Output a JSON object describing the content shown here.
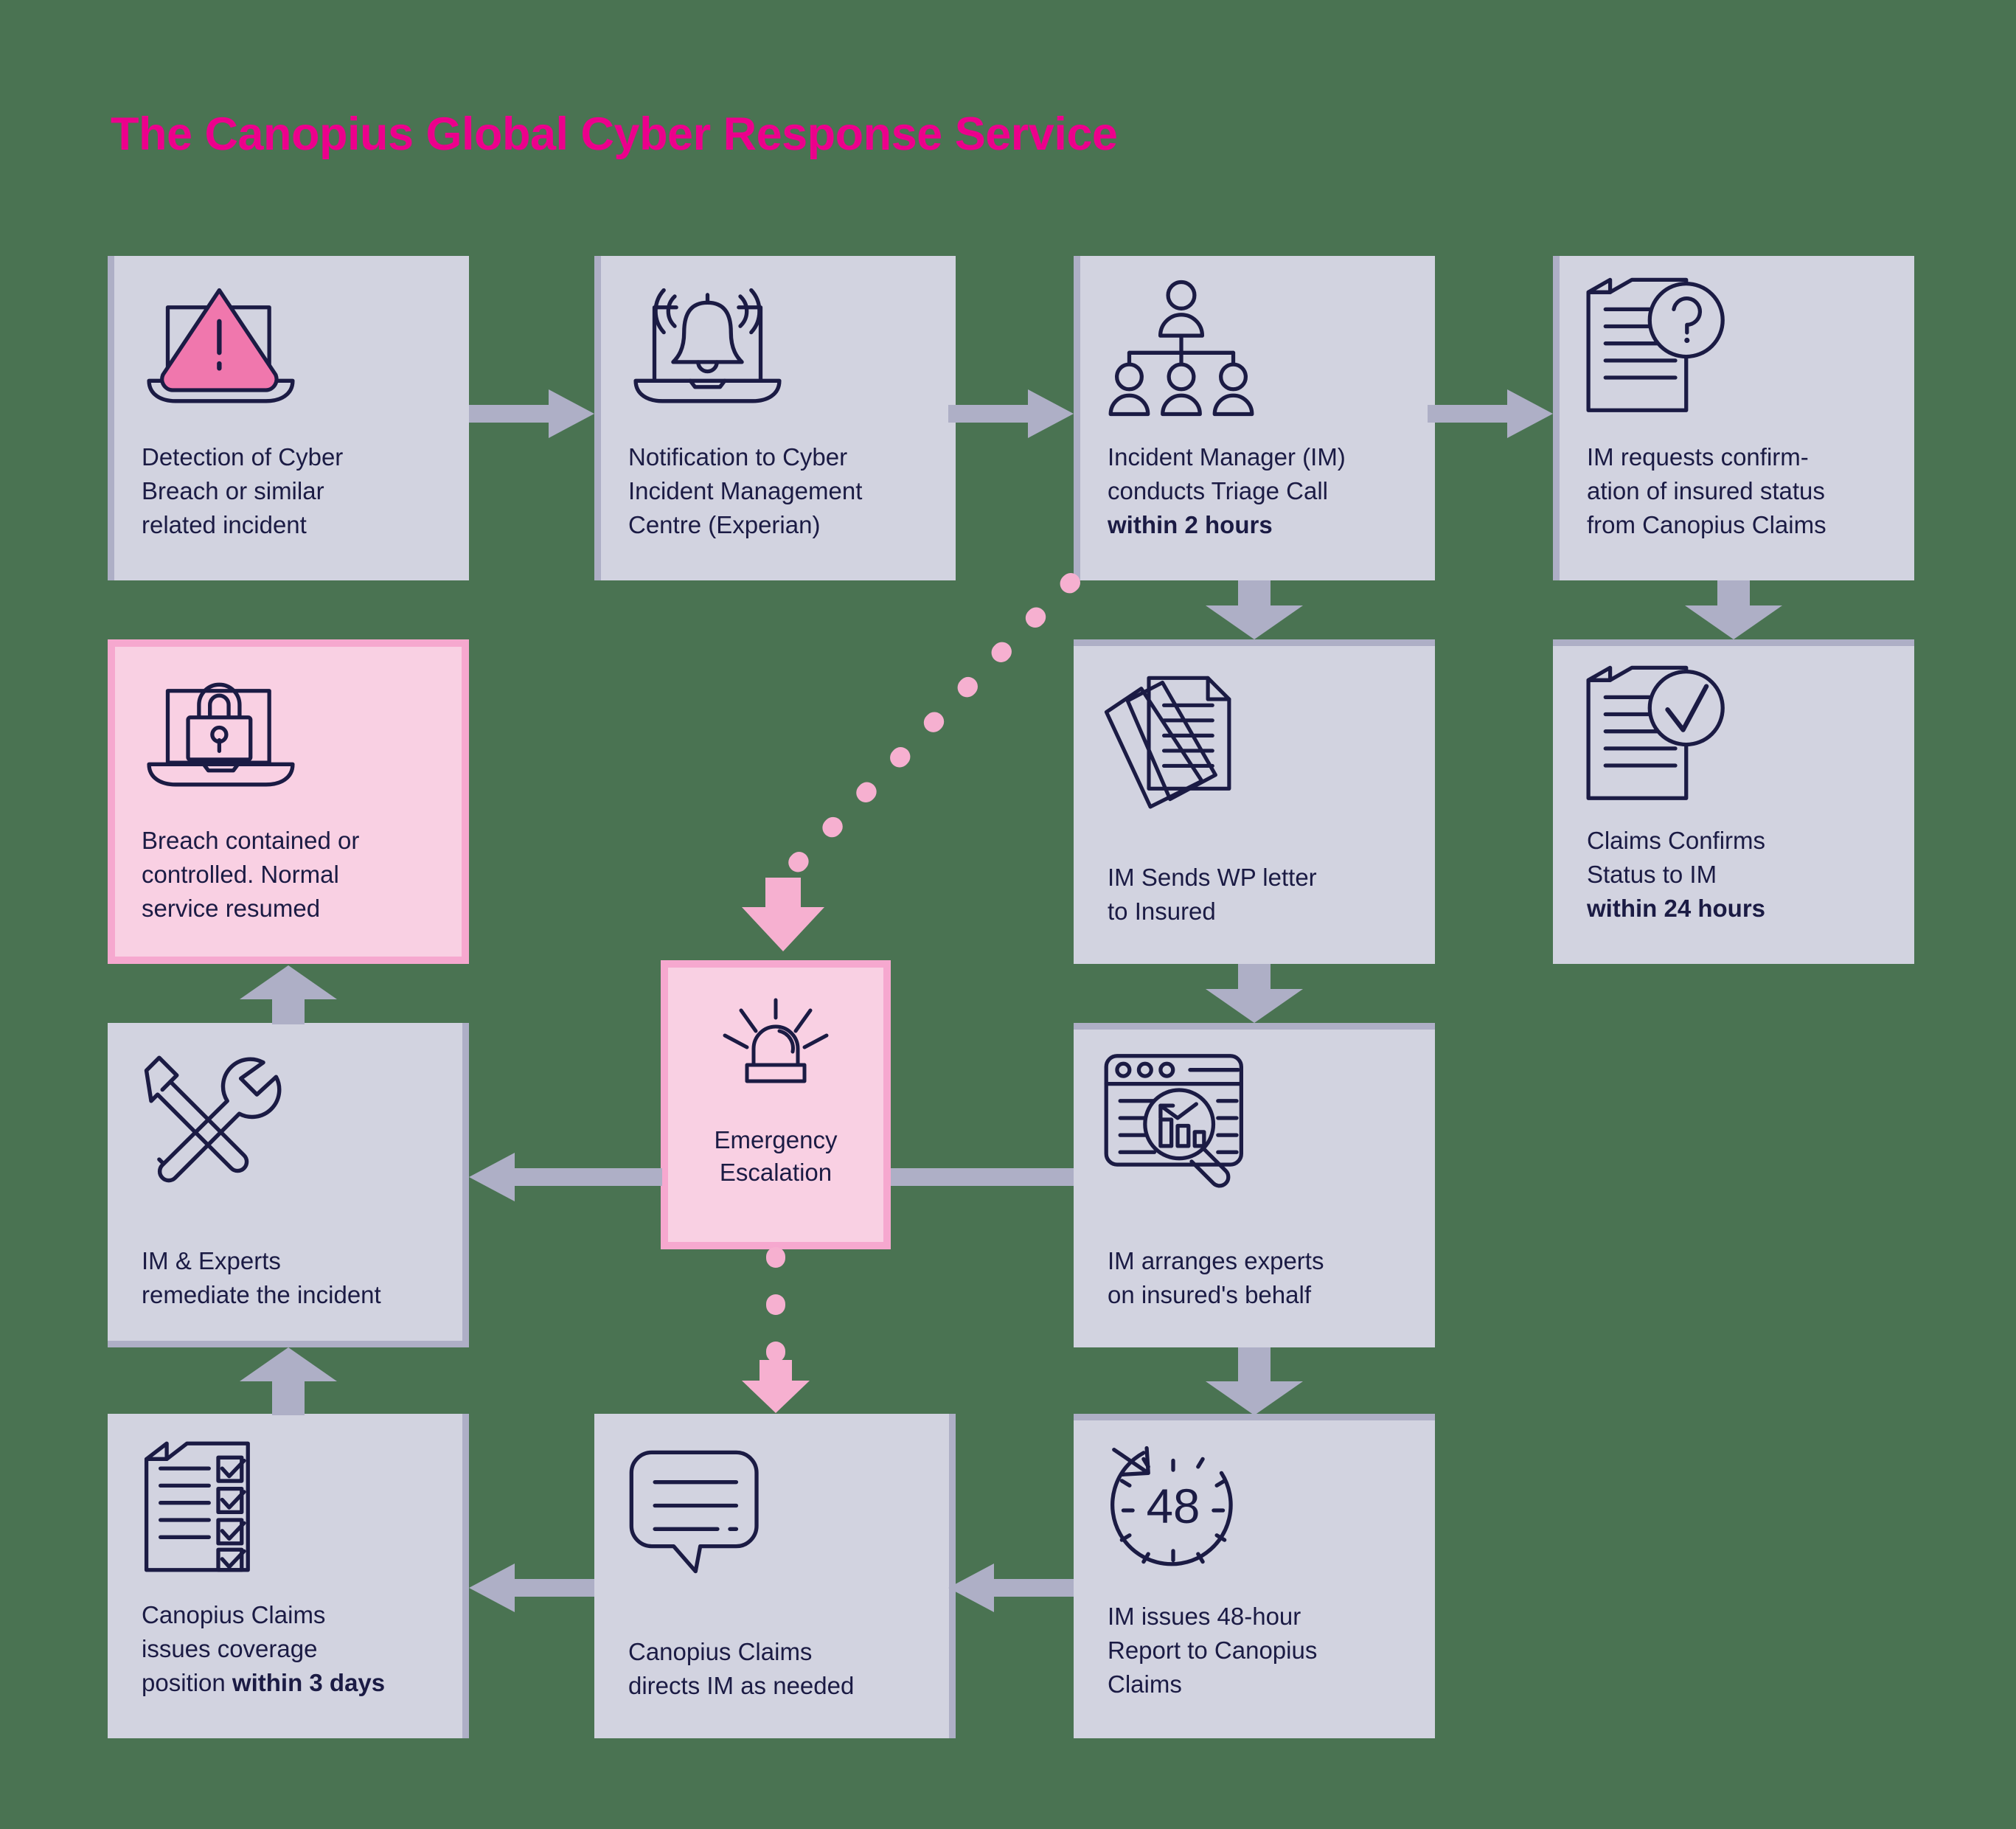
{
  "title": "The Canopius Global Cyber Response Service",
  "colors": {
    "background": "#4a7352",
    "title_pink": "#ec008c",
    "box_fill": "#d2d3e0",
    "box_edge": "#aeafc6",
    "pink_fill": "#f9d0e3",
    "pink_border": "#f6a8cf",
    "ink": "#1b1b44",
    "arrow_grey": "#aeafc6",
    "arrow_pink": "#f6b0d0"
  },
  "nodes": [
    {
      "id": "detection",
      "icon": "laptop-warning-icon",
      "lines": [
        {
          "text": "Detection of Cyber",
          "bold": false
        },
        {
          "text": "Breach or similar",
          "bold": false
        },
        {
          "text": "related incident",
          "bold": false
        }
      ]
    },
    {
      "id": "notification",
      "icon": "laptop-bell-icon",
      "lines": [
        {
          "text": "Notification to Cyber",
          "bold": false
        },
        {
          "text": "Incident Management",
          "bold": false
        },
        {
          "text": "Centre (Experian)",
          "bold": false
        }
      ]
    },
    {
      "id": "triage",
      "icon": "org-chart-icon",
      "lines": [
        {
          "text": "Incident Manager (IM)",
          "bold": false
        },
        {
          "text": "conducts Triage Call",
          "bold": false
        },
        {
          "text": "within 2 hours",
          "bold": true
        }
      ]
    },
    {
      "id": "confirmation-request",
      "icon": "document-question-icon",
      "lines": [
        {
          "text": "IM requests confirm-",
          "bold": false
        },
        {
          "text": "ation of insured status",
          "bold": false
        },
        {
          "text": "from Canopius Claims",
          "bold": false
        }
      ]
    },
    {
      "id": "breach-contained",
      "icon": "laptop-lock-icon",
      "lines": [
        {
          "text": "Breach contained or",
          "bold": false
        },
        {
          "text": "controlled. Normal",
          "bold": false
        },
        {
          "text": "service resumed",
          "bold": false
        }
      ]
    },
    {
      "id": "wp-letter",
      "icon": "document-stack-icon",
      "lines": [
        {
          "text": "IM Sends WP letter",
          "bold": false
        },
        {
          "text": "to Insured",
          "bold": false
        }
      ]
    },
    {
      "id": "claims-confirms",
      "icon": "document-check-icon",
      "lines": [
        {
          "text": "Claims Confirms",
          "bold": false
        },
        {
          "text": "Status to IM",
          "bold": false
        },
        {
          "text": "within 24 hours",
          "bold": true
        }
      ]
    },
    {
      "id": "emergency-escalation",
      "icon": "siren-icon",
      "lines": [
        {
          "text": "Emergency",
          "bold": false
        },
        {
          "text": "Escalation",
          "bold": false
        }
      ]
    },
    {
      "id": "remediate",
      "icon": "tools-icon",
      "lines": [
        {
          "text": "IM & Experts",
          "bold": false
        },
        {
          "text": "remediate the incident",
          "bold": false
        }
      ]
    },
    {
      "id": "arrange-experts",
      "icon": "dashboard-magnifier-icon",
      "lines": [
        {
          "text": "IM arranges experts",
          "bold": false
        },
        {
          "text": "on insured's behalf",
          "bold": false
        }
      ]
    },
    {
      "id": "coverage-position",
      "icon": "checklist-icon",
      "lines": [
        {
          "text": "Canopius Claims",
          "bold": false
        },
        {
          "text": "issues coverage",
          "bold": false
        },
        {
          "text": "position within 3 days",
          "bold": false,
          "bold_tail": "within 3 days"
        }
      ]
    },
    {
      "id": "claims-directs",
      "icon": "speech-bubble-icon",
      "lines": [
        {
          "text": "Canopius Claims",
          "bold": false
        },
        {
          "text": "directs IM as needed",
          "bold": false
        }
      ]
    },
    {
      "id": "report-48h",
      "icon": "clock-48-icon",
      "lines": [
        {
          "text": "IM issues 48-hour",
          "bold": false
        },
        {
          "text": "Report to Canopius",
          "bold": false
        },
        {
          "text": "Claims",
          "bold": false
        }
      ]
    }
  ],
  "labels": {
    "detection_l1": "Detection of Cyber",
    "detection_l2": "Breach or similar",
    "detection_l3": "related incident",
    "notification_l1": "Notification to Cyber",
    "notification_l2": "Incident Management",
    "notification_l3": "Centre (Experian)",
    "triage_l1": "Incident Manager (IM)",
    "triage_l2": "conducts Triage Call",
    "triage_l3": "within 2 hours",
    "confirm_l1": "IM requests confirm-",
    "confirm_l2": "ation of insured status",
    "confirm_l3": "from Canopius Claims",
    "breach_l1": "Breach contained or",
    "breach_l2": "controlled. Normal",
    "breach_l3": "service resumed",
    "wp_l1": "IM Sends WP letter",
    "wp_l2": "to Insured",
    "claims_l1": "Claims Confirms",
    "claims_l2": "Status to IM",
    "claims_l3": "within 24 hours",
    "emergency_l1": "Emergency",
    "emergency_l2": "Escalation",
    "remediate_l1": "IM & Experts",
    "remediate_l2": "remediate the incident",
    "experts_l1": "IM arranges experts",
    "experts_l2": "on insured's behalf",
    "coverage_l1": "Canopius Claims",
    "coverage_l2": "issues coverage",
    "coverage_l3a": "position ",
    "coverage_l3b": "within 3 days",
    "directs_l1": "Canopius Claims",
    "directs_l2": "directs IM as needed",
    "report_l1": "IM issues 48-hour",
    "report_l2": "Report to Canopius",
    "report_l3": "Claims",
    "clock_value": "48"
  }
}
